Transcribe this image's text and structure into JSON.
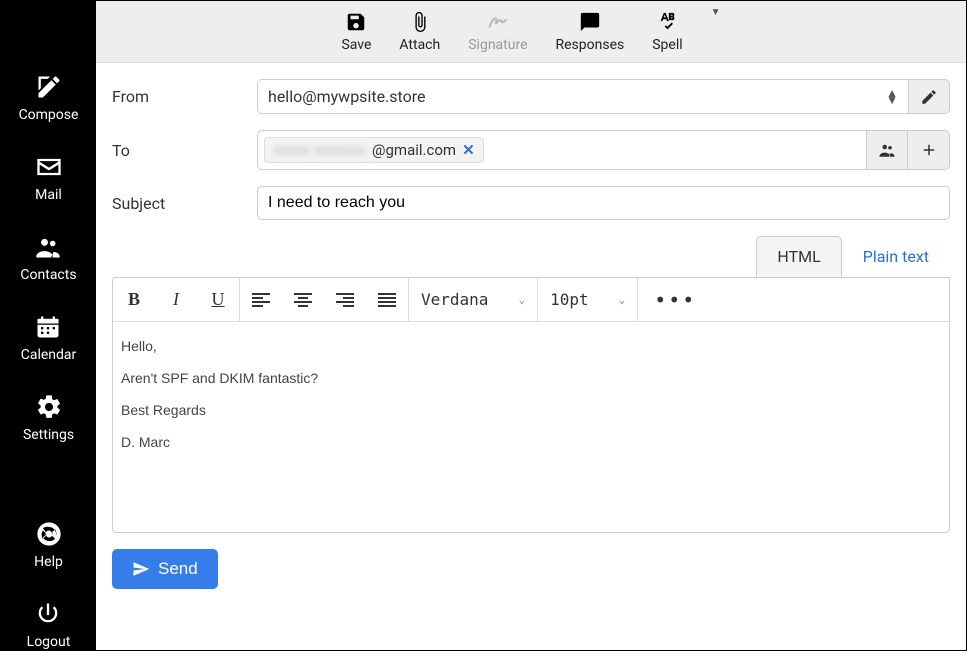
{
  "sidebar": {
    "items": [
      {
        "label": "Compose"
      },
      {
        "label": "Mail"
      },
      {
        "label": "Contacts"
      },
      {
        "label": "Calendar"
      },
      {
        "label": "Settings"
      }
    ],
    "bottom": [
      {
        "label": "Help"
      },
      {
        "label": "Logout"
      }
    ]
  },
  "toolbar": {
    "save": "Save",
    "attach": "Attach",
    "signature": "Signature",
    "responses": "Responses",
    "spell": "Spell"
  },
  "headers": {
    "from_label": "From",
    "from_value": "hello@mywpsite.store",
    "to_label": "To",
    "to_chip_blur": "xxxxx xxxxxxx",
    "to_chip_visible": "@gmail.com",
    "subject_label": "Subject",
    "subject_value": "I need to reach you"
  },
  "format": {
    "html_tab": "HTML",
    "plain_tab": "Plain text",
    "font_family": "Verdana",
    "font_size": "10pt"
  },
  "body": {
    "p1": "Hello,",
    "p2": "Aren't SPF and DKIM fantastic?",
    "p3": "Best Regards",
    "p4": "D. Marc"
  },
  "footer": {
    "send": "Send"
  }
}
